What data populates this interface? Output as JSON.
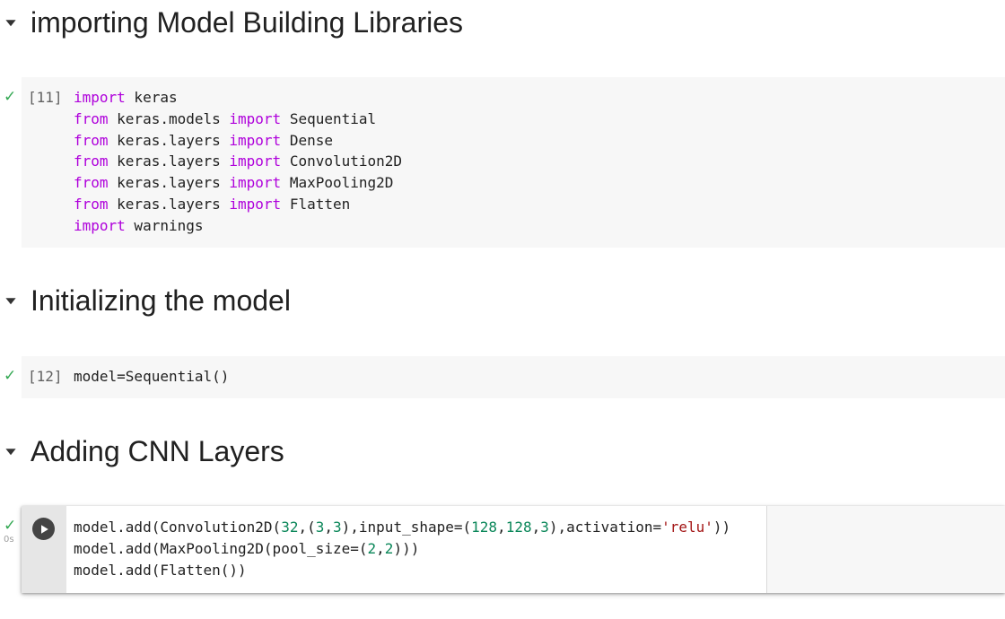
{
  "sections": [
    {
      "title": "importing Model Building Libraries"
    },
    {
      "title": "Initializing the model"
    },
    {
      "title": "Adding CNN Layers"
    }
  ],
  "cells": [
    {
      "status": "✓",
      "exec_count": "[11]",
      "lines": [
        "import keras",
        "from keras.models import Sequential",
        "from keras.layers import Dense",
        "from keras.layers import Convolution2D",
        "from keras.layers import MaxPooling2D",
        "from keras.layers import Flatten",
        "import warnings"
      ]
    },
    {
      "status": "✓",
      "exec_count": "[12]",
      "lines": [
        "model=Sequential()"
      ]
    },
    {
      "status": "✓",
      "exec_time": "0s",
      "lines": [
        "model.add(Convolution2D(32,(3,3),input_shape=(128,128,3),activation='relu'))",
        "model.add(MaxPooling2D(pool_size=(2,2)))",
        "model.add(Flatten())"
      ]
    }
  ],
  "icons": {
    "collapse": "caret-down-icon",
    "run": "play-icon",
    "status": "checkmark-icon"
  },
  "colors": {
    "keyword": "#af00db",
    "number": "#098658",
    "string": "#a31515",
    "success": "#34a853"
  }
}
